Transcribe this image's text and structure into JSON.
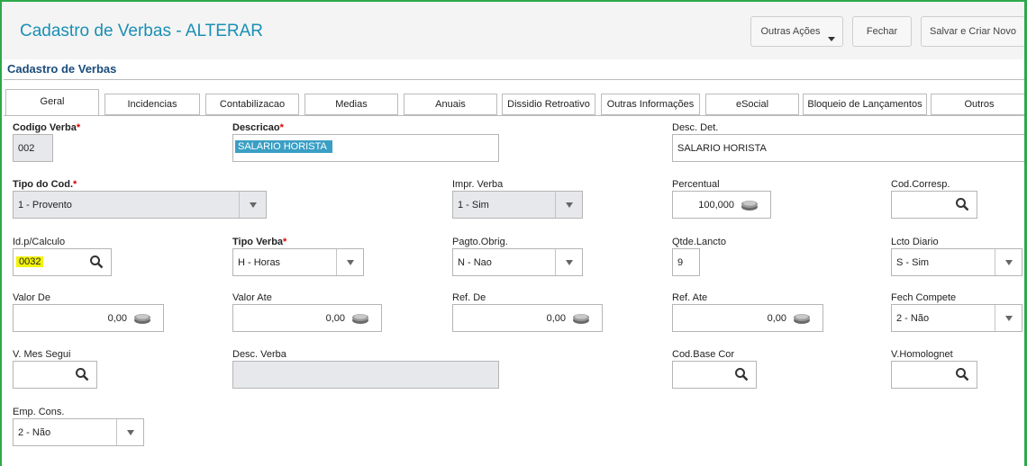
{
  "header": {
    "title": "Cadastro de Verbas - ALTERAR",
    "buttons": {
      "outras_acoes": "Outras Ações",
      "fechar": "Fechar",
      "salvar_criar": "Salvar e Criar Novo"
    }
  },
  "section": {
    "title": "Cadastro de Verbas"
  },
  "tabs": [
    "Geral",
    "Incidencias",
    "Contabilizacao",
    "Medias",
    "Anuais",
    "Dissidio Retroativo",
    "Outras Informações",
    "eSocial",
    "Bloqueio de Lançamentos",
    "Outros"
  ],
  "form": {
    "codigo_verba": {
      "label": "Codigo Verba",
      "value": "002"
    },
    "descricao": {
      "label": "Descricao",
      "value": "SALARIO HORISTA"
    },
    "desc_det": {
      "label": "Desc. Det.",
      "value": "SALARIO HORISTA"
    },
    "tipo_cod": {
      "label": "Tipo do Cod.",
      "value": "1 - Provento"
    },
    "impr_verba": {
      "label": "Impr. Verba",
      "value": "1 - Sim"
    },
    "percentual": {
      "label": "Percentual",
      "value": "100,000"
    },
    "cod_corresp": {
      "label": "Cod.Corresp.",
      "value": ""
    },
    "id_calculo": {
      "label": "Id.p/Calculo",
      "value": "0032"
    },
    "tipo_verba": {
      "label": "Tipo Verba",
      "value": "H - Horas"
    },
    "pagto_obrig": {
      "label": "Pagto.Obrig.",
      "value": "N - Nao"
    },
    "qtde_lancto": {
      "label": "Qtde.Lancto",
      "value": "9"
    },
    "lcto_diario": {
      "label": "Lcto Diario",
      "value": "S - Sim"
    },
    "valor_de": {
      "label": "Valor De",
      "value": "0,00"
    },
    "valor_ate": {
      "label": "Valor Ate",
      "value": "0,00"
    },
    "ref_de": {
      "label": "Ref. De",
      "value": "0,00"
    },
    "ref_ate": {
      "label": "Ref. Ate",
      "value": "0,00"
    },
    "fech_compete": {
      "label": "Fech Compete",
      "value": "2 - Não"
    },
    "v_mes_segui": {
      "label": "V. Mes Segui",
      "value": ""
    },
    "desc_verba": {
      "label": "Desc. Verba",
      "value": ""
    },
    "cod_base_cor": {
      "label": "Cod.Base Cor",
      "value": ""
    },
    "v_homolognet": {
      "label": "V.Homolognet",
      "value": ""
    },
    "emp_cons": {
      "label": "Emp. Cons.",
      "value": "2 - Não"
    }
  },
  "colors": {
    "accent": "#1a8fb5",
    "section_title": "#1a4c7c",
    "required_star": "#d00000",
    "frame": "#2ea84a"
  },
  "icons": {
    "search": "search-icon",
    "coin": "coin-stack-icon",
    "dropdown": "chevron-down-icon"
  }
}
